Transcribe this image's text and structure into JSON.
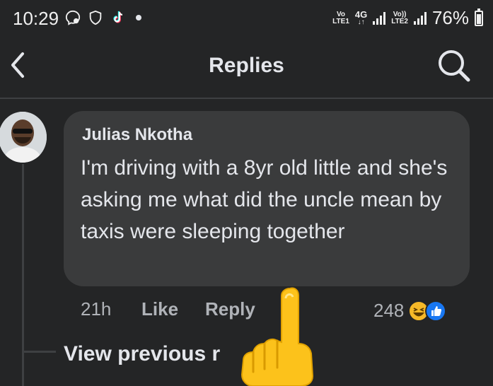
{
  "status_bar": {
    "time": "10:29",
    "sim1_top": "Vo",
    "sim1_bottom": "LTE1",
    "network_type": "4G",
    "sim2_top": "Vo))",
    "sim2_bottom": "LTE2",
    "battery": "76%",
    "icons": [
      "messenger-icon",
      "shield-icon",
      "tiktok-icon"
    ]
  },
  "header": {
    "title": "Replies",
    "back_icon": "chevron-left-icon",
    "search_icon": "search-icon"
  },
  "comment": {
    "author": "Julias Nkotha",
    "text": "I'm driving with a 8yr old little and she's asking me what did the uncle mean by taxis were sleeping together",
    "time": "21h",
    "like_label": "Like",
    "reply_label": "Reply",
    "reaction_count": "248",
    "reactions": [
      "laugh-reaction-icon",
      "like-reaction-icon"
    ]
  },
  "thread": {
    "view_previous_label": "View previous r"
  },
  "colors": {
    "background": "#242526",
    "bubble": "#3a3b3c",
    "text_primary": "#e4e6eb",
    "text_secondary": "#b0b3b8",
    "like_blue": "#1877f2"
  }
}
